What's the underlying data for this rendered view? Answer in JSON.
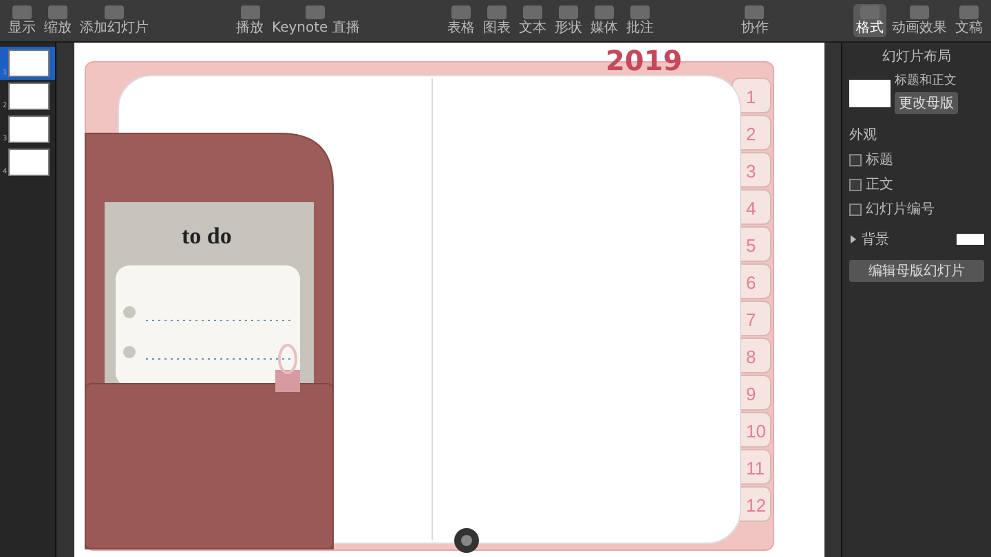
{
  "toolbar": {
    "groups": [
      {
        "items": [
          {
            "label": "显示",
            "selected": false
          },
          {
            "label": "缩放",
            "selected": false
          },
          {
            "label": "添加幻灯片",
            "selected": false
          }
        ]
      },
      {
        "items": [
          {
            "label": "播放",
            "selected": false
          },
          {
            "label": "Keynote 直播",
            "selected": false
          }
        ]
      },
      {
        "items": [
          {
            "label": "表格",
            "selected": false
          },
          {
            "label": "图表",
            "selected": false
          },
          {
            "label": "文本",
            "selected": false
          },
          {
            "label": "形状",
            "selected": false
          },
          {
            "label": "媒体",
            "selected": false
          },
          {
            "label": "批注",
            "selected": false
          }
        ]
      },
      {
        "items": [
          {
            "label": "协作",
            "selected": false
          }
        ]
      },
      {
        "items": [
          {
            "label": "格式",
            "selected": true
          },
          {
            "label": "动画效果",
            "selected": false
          },
          {
            "label": "文稿",
            "selected": false
          }
        ]
      }
    ]
  },
  "slides": [
    {
      "number": "1",
      "selected": true
    },
    {
      "number": "2",
      "selected": false
    },
    {
      "number": "3",
      "selected": false
    },
    {
      "number": "4",
      "selected": false
    }
  ],
  "slide": {
    "year": "2019",
    "pocket_title": "to do",
    "tabs": [
      "1",
      "2",
      "3",
      "4",
      "5",
      "6",
      "7",
      "8",
      "9",
      "10",
      "11",
      "12"
    ]
  },
  "inspector": {
    "title": "幻灯片布局",
    "layout_name": "标题和正文",
    "change_button": "更改母版",
    "appearance_label": "外观",
    "options": [
      {
        "label": "标题",
        "checked": false
      },
      {
        "label": "正文",
        "checked": false
      },
      {
        "label": "幻灯片编号",
        "checked": false
      }
    ],
    "background": {
      "label": "背景",
      "expanded": false
    },
    "edit_button": "编辑母版幻灯片"
  }
}
